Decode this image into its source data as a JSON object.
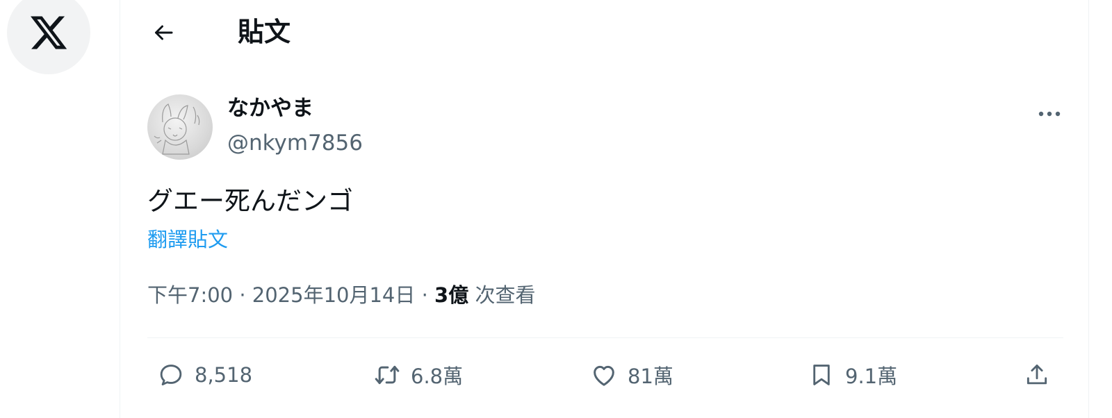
{
  "header": {
    "title": "貼文"
  },
  "tweet": {
    "display_name": "なかやま",
    "handle": "@nkym7856",
    "text": "グエー死んだンゴ",
    "translate_label": "翻譯貼文",
    "time": "下午7:00",
    "date": "2025年10月14日",
    "views_count": "3億",
    "views_label": "次查看"
  },
  "actions": {
    "reply_count": "8,518",
    "retweet_count": "6.8萬",
    "like_count": "81萬",
    "bookmark_count": "9.1萬"
  },
  "icons": [
    "x-logo-icon",
    "back-arrow-icon",
    "more-icon",
    "reply-icon",
    "retweet-icon",
    "like-icon",
    "bookmark-icon",
    "share-icon"
  ],
  "colors": {
    "link": "#1d9bf0",
    "secondary_text": "#536471",
    "primary_text": "#0f1419"
  }
}
